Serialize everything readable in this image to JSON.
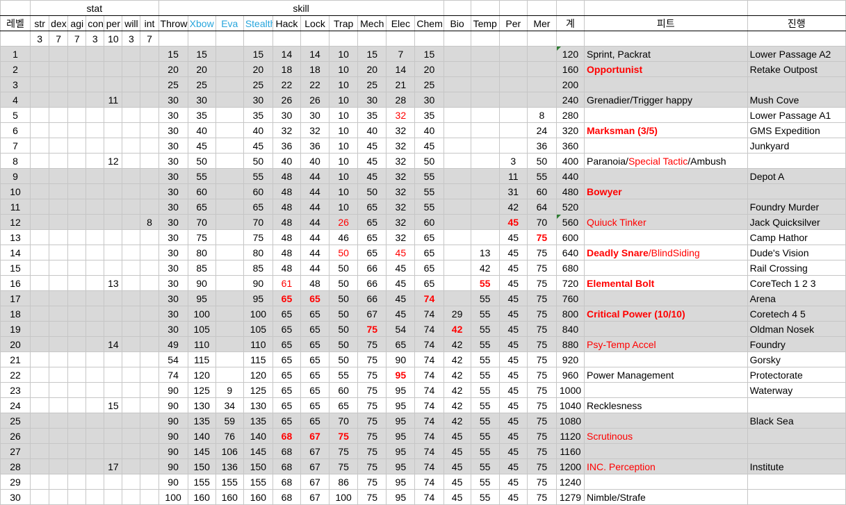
{
  "header": {
    "group_stat": "stat",
    "group_skill": "skill",
    "level": "레벨",
    "stats": [
      "str",
      "dex",
      "agi",
      "con",
      "per",
      "will",
      "int"
    ],
    "skills": [
      "Throw",
      "Xbow",
      "Eva",
      "Stealth",
      "Hack",
      "Lock",
      "Trap",
      "Mech",
      "Elec",
      "Chem",
      "Bio",
      "Temp",
      "Per",
      "Mer"
    ],
    "total": "계",
    "feat": "피트",
    "progress": "진행"
  },
  "base_stats": [
    "3",
    "7",
    "7",
    "3",
    "10",
    "3",
    "7"
  ],
  "rows": [
    {
      "level": "1",
      "stats": [
        "",
        "",
        "",
        "",
        "",
        "",
        ""
      ],
      "skills": [
        "15",
        "15",
        "",
        "15",
        "14",
        "14",
        "10",
        "15",
        "7",
        "15",
        "",
        "",
        "",
        ""
      ],
      "total": "120",
      "feat": [
        {
          "text": "Sprint, Packrat"
        }
      ],
      "progress": "Lower Passage A2",
      "shaded": true
    },
    {
      "level": "2",
      "stats": [
        "",
        "",
        "",
        "",
        "",
        "",
        ""
      ],
      "skills": [
        "20",
        "20",
        "",
        "20",
        "18",
        "18",
        "10",
        "20",
        "14",
        "20",
        "",
        "",
        "",
        ""
      ],
      "total": "160",
      "feat": [
        {
          "text": "Opportunist",
          "red": true,
          "bold": true
        }
      ],
      "progress": "Retake Outpost",
      "shaded": true
    },
    {
      "level": "3",
      "stats": [
        "",
        "",
        "",
        "",
        "",
        "",
        ""
      ],
      "skills": [
        "25",
        "25",
        "",
        "25",
        "22",
        "22",
        "10",
        "25",
        "21",
        "25",
        "",
        "",
        "",
        ""
      ],
      "total": "200",
      "feat": [],
      "progress": "",
      "shaded": true
    },
    {
      "level": "4",
      "stats": [
        "",
        "",
        "",
        "",
        "11",
        "",
        ""
      ],
      "skills": [
        "30",
        "30",
        "",
        "30",
        "26",
        "26",
        "10",
        "30",
        "28",
        "30",
        "",
        "",
        "",
        ""
      ],
      "total": "240",
      "feat": [
        {
          "text": "Grenadier/Trigger happy"
        }
      ],
      "progress": "Mush Cove",
      "shaded": true
    },
    {
      "level": "5",
      "stats": [
        "",
        "",
        "",
        "",
        "",
        "",
        ""
      ],
      "skills": [
        "30",
        "35",
        "",
        "35",
        "30",
        "30",
        "10",
        "35",
        "32",
        "35",
        "",
        "",
        "",
        "8"
      ],
      "total": "280",
      "feat": [],
      "progress": "Lower Passage A1",
      "shaded": false
    },
    {
      "level": "6",
      "stats": [
        "",
        "",
        "",
        "",
        "",
        "",
        ""
      ],
      "skills": [
        "30",
        "40",
        "",
        "40",
        "32",
        "32",
        "10",
        "40",
        "32",
        "40",
        "",
        "",
        "",
        "24"
      ],
      "total": "320",
      "feat": [
        {
          "text": "Marksman (3/5)",
          "red": true,
          "bold": true
        }
      ],
      "progress": "GMS Expedition",
      "shaded": false
    },
    {
      "level": "7",
      "stats": [
        "",
        "",
        "",
        "",
        "",
        "",
        ""
      ],
      "skills": [
        "30",
        "45",
        "",
        "45",
        "36",
        "36",
        "10",
        "45",
        "32",
        "45",
        "",
        "",
        "",
        "36"
      ],
      "total": "360",
      "feat": [],
      "progress": "Junkyard",
      "shaded": false
    },
    {
      "level": "8",
      "stats": [
        "",
        "",
        "",
        "",
        "12",
        "",
        ""
      ],
      "skills": [
        "30",
        "50",
        "",
        "50",
        "40",
        "40",
        "10",
        "45",
        "32",
        "50",
        "",
        "",
        "3",
        "50"
      ],
      "total": "400",
      "feat": [
        {
          "text": "Paranoia/"
        },
        {
          "text": "Special Tactic",
          "red": true
        },
        {
          "text": "/Ambush"
        }
      ],
      "progress": "",
      "shaded": false
    },
    {
      "level": "9",
      "stats": [
        "",
        "",
        "",
        "",
        "",
        "",
        ""
      ],
      "skills": [
        "30",
        "55",
        "",
        "55",
        "48",
        "44",
        "10",
        "45",
        "32",
        "55",
        "",
        "",
        "11",
        "55"
      ],
      "total": "440",
      "feat": [],
      "progress": "Depot A",
      "shaded": true
    },
    {
      "level": "10",
      "stats": [
        "",
        "",
        "",
        "",
        "",
        "",
        ""
      ],
      "skills": [
        "30",
        "60",
        "",
        "60",
        "48",
        "44",
        "10",
        "50",
        "32",
        "55",
        "",
        "",
        "31",
        "60"
      ],
      "total": "480",
      "feat": [
        {
          "text": "Bowyer",
          "red": true,
          "bold": true
        }
      ],
      "progress": "",
      "shaded": true
    },
    {
      "level": "11",
      "stats": [
        "",
        "",
        "",
        "",
        "",
        "",
        ""
      ],
      "skills": [
        "30",
        "65",
        "",
        "65",
        "48",
        "44",
        "10",
        "65",
        "32",
        "55",
        "",
        "",
        "42",
        "64"
      ],
      "total": "520",
      "feat": [],
      "progress": "Foundry Murder",
      "shaded": true
    },
    {
      "level": "12",
      "stats": [
        "",
        "",
        "",
        "",
        "",
        "",
        "8"
      ],
      "skills": [
        "30",
        "70",
        "",
        "70",
        "48",
        "44",
        "26",
        "65",
        "32",
        "60",
        "",
        "",
        "45",
        "70"
      ],
      "total": "560",
      "feat": [
        {
          "text": "Quiuck Tinker",
          "red": true
        }
      ],
      "progress": "Jack Quicksilver",
      "shaded": true
    },
    {
      "level": "13",
      "stats": [
        "",
        "",
        "",
        "",
        "",
        "",
        ""
      ],
      "skills": [
        "30",
        "75",
        "",
        "75",
        "48",
        "44",
        "46",
        "65",
        "32",
        "65",
        "",
        "",
        "45",
        "75"
      ],
      "total": "600",
      "feat": [],
      "progress": "Camp Hathor",
      "shaded": false
    },
    {
      "level": "14",
      "stats": [
        "",
        "",
        "",
        "",
        "",
        "",
        ""
      ],
      "skills": [
        "30",
        "80",
        "",
        "80",
        "48",
        "44",
        "50",
        "65",
        "45",
        "65",
        "",
        "13",
        "45",
        "75"
      ],
      "total": "640",
      "feat": [
        {
          "text": "Deadly Snare",
          "red": true,
          "bold": true
        },
        {
          "text": "/BlindSiding",
          "red": true
        }
      ],
      "progress": "Dude's Vision",
      "shaded": false
    },
    {
      "level": "15",
      "stats": [
        "",
        "",
        "",
        "",
        "",
        "",
        ""
      ],
      "skills": [
        "30",
        "85",
        "",
        "85",
        "48",
        "44",
        "50",
        "66",
        "45",
        "65",
        "",
        "42",
        "45",
        "75"
      ],
      "total": "680",
      "feat": [],
      "progress": "Rail Crossing",
      "shaded": false
    },
    {
      "level": "16",
      "stats": [
        "",
        "",
        "",
        "",
        "13",
        "",
        ""
      ],
      "skills": [
        "30",
        "90",
        "",
        "90",
        "61",
        "48",
        "50",
        "66",
        "45",
        "65",
        "",
        "55",
        "45",
        "75"
      ],
      "total": "720",
      "feat": [
        {
          "text": "Elemental Bolt",
          "red": true,
          "bold": true
        }
      ],
      "progress": "CoreTech 1 2 3",
      "shaded": false
    },
    {
      "level": "17",
      "stats": [
        "",
        "",
        "",
        "",
        "",
        "",
        ""
      ],
      "skills": [
        "30",
        "95",
        "",
        "95",
        "65",
        "65",
        "50",
        "66",
        "45",
        "74",
        "",
        "55",
        "45",
        "75"
      ],
      "total": "760",
      "feat": [],
      "progress": "Arena",
      "shaded": true
    },
    {
      "level": "18",
      "stats": [
        "",
        "",
        "",
        "",
        "",
        "",
        ""
      ],
      "skills": [
        "30",
        "100",
        "",
        "100",
        "65",
        "65",
        "50",
        "67",
        "45",
        "74",
        "29",
        "55",
        "45",
        "75"
      ],
      "total": "800",
      "feat": [
        {
          "text": "Critical Power (10/10)",
          "red": true,
          "bold": true
        }
      ],
      "progress": "Coretech 4 5",
      "shaded": true
    },
    {
      "level": "19",
      "stats": [
        "",
        "",
        "",
        "",
        "",
        "",
        ""
      ],
      "skills": [
        "30",
        "105",
        "",
        "105",
        "65",
        "65",
        "50",
        "75",
        "54",
        "74",
        "42",
        "55",
        "45",
        "75"
      ],
      "total": "840",
      "feat": [],
      "progress": "Oldman Nosek",
      "shaded": true
    },
    {
      "level": "20",
      "stats": [
        "",
        "",
        "",
        "",
        "14",
        "",
        ""
      ],
      "skills": [
        "49",
        "110",
        "",
        "110",
        "65",
        "65",
        "50",
        "75",
        "65",
        "74",
        "42",
        "55",
        "45",
        "75"
      ],
      "total": "880",
      "feat": [
        {
          "text": "Psy-Temp Accel",
          "red": true
        }
      ],
      "progress": "Foundry",
      "shaded": true
    },
    {
      "level": "21",
      "stats": [
        "",
        "",
        "",
        "",
        "",
        "",
        ""
      ],
      "skills": [
        "54",
        "115",
        "",
        "115",
        "65",
        "65",
        "50",
        "75",
        "90",
        "74",
        "42",
        "55",
        "45",
        "75"
      ],
      "total": "920",
      "feat": [],
      "progress": "Gorsky",
      "shaded": false
    },
    {
      "level": "22",
      "stats": [
        "",
        "",
        "",
        "",
        "",
        "",
        ""
      ],
      "skills": [
        "74",
        "120",
        "",
        "120",
        "65",
        "65",
        "55",
        "75",
        "95",
        "74",
        "42",
        "55",
        "45",
        "75"
      ],
      "total": "960",
      "feat": [
        {
          "text": "Power Management"
        }
      ],
      "progress": "Protectorate",
      "shaded": false
    },
    {
      "level": "23",
      "stats": [
        "",
        "",
        "",
        "",
        "",
        "",
        ""
      ],
      "skills": [
        "90",
        "125",
        "9",
        "125",
        "65",
        "65",
        "60",
        "75",
        "95",
        "74",
        "42",
        "55",
        "45",
        "75"
      ],
      "total": "1000",
      "feat": [],
      "progress": "Waterway",
      "shaded": false
    },
    {
      "level": "24",
      "stats": [
        "",
        "",
        "",
        "",
        "15",
        "",
        ""
      ],
      "skills": [
        "90",
        "130",
        "34",
        "130",
        "65",
        "65",
        "65",
        "75",
        "95",
        "74",
        "42",
        "55",
        "45",
        "75"
      ],
      "total": "1040",
      "feat": [
        {
          "text": "Recklesness"
        }
      ],
      "progress": "",
      "shaded": false
    },
    {
      "level": "25",
      "stats": [
        "",
        "",
        "",
        "",
        "",
        "",
        ""
      ],
      "skills": [
        "90",
        "135",
        "59",
        "135",
        "65",
        "65",
        "70",
        "75",
        "95",
        "74",
        "42",
        "55",
        "45",
        "75"
      ],
      "total": "1080",
      "feat": [],
      "progress": "Black Sea",
      "shaded": true
    },
    {
      "level": "26",
      "stats": [
        "",
        "",
        "",
        "",
        "",
        "",
        ""
      ],
      "skills": [
        "90",
        "140",
        "76",
        "140",
        "68",
        "67",
        "75",
        "75",
        "95",
        "74",
        "45",
        "55",
        "45",
        "75"
      ],
      "total": "1120",
      "feat": [
        {
          "text": "Scrutinous",
          "red": true
        }
      ],
      "progress": "",
      "shaded": true
    },
    {
      "level": "27",
      "stats": [
        "",
        "",
        "",
        "",
        "",
        "",
        ""
      ],
      "skills": [
        "90",
        "145",
        "106",
        "145",
        "68",
        "67",
        "75",
        "75",
        "95",
        "74",
        "45",
        "55",
        "45",
        "75"
      ],
      "total": "1160",
      "feat": [],
      "progress": "",
      "shaded": true
    },
    {
      "level": "28",
      "stats": [
        "",
        "",
        "",
        "",
        "17",
        "",
        ""
      ],
      "skills": [
        "90",
        "150",
        "136",
        "150",
        "68",
        "67",
        "75",
        "75",
        "95",
        "74",
        "45",
        "55",
        "45",
        "75"
      ],
      "total": "1200",
      "feat": [
        {
          "text": "INC. Perception",
          "red": true
        }
      ],
      "progress": "Institute",
      "shaded": true
    },
    {
      "level": "29",
      "stats": [
        "",
        "",
        "",
        "",
        "",
        "",
        ""
      ],
      "skills": [
        "90",
        "155",
        "155",
        "155",
        "68",
        "67",
        "86",
        "75",
        "95",
        "74",
        "45",
        "55",
        "45",
        "75"
      ],
      "total": "1240",
      "feat": [],
      "progress": "",
      "shaded": false
    },
    {
      "level": "30",
      "stats": [
        "",
        "",
        "",
        "",
        "",
        "",
        ""
      ],
      "skills": [
        "100",
        "160",
        "160",
        "160",
        "68",
        "67",
        "100",
        "75",
        "95",
        "74",
        "45",
        "55",
        "45",
        "75"
      ],
      "total": "1279",
      "feat": [
        {
          "text": "Nimble/Strafe"
        }
      ],
      "progress": "",
      "shaded": false
    }
  ],
  "highlights": [
    {
      "level": "5",
      "skill": 8
    },
    {
      "level": "12",
      "skill": 6
    },
    {
      "level": "12",
      "skill": 12,
      "bold": true
    },
    {
      "level": "13",
      "skill": 13,
      "bold": true
    },
    {
      "level": "14",
      "skill": 6
    },
    {
      "level": "14",
      "skill": 8
    },
    {
      "level": "16",
      "skill": 4
    },
    {
      "level": "16",
      "skill": 11,
      "bold": true
    },
    {
      "level": "17",
      "skill": 4,
      "bold": true
    },
    {
      "level": "17",
      "skill": 5,
      "bold": true
    },
    {
      "level": "17",
      "skill": 9,
      "bold": true
    },
    {
      "level": "19",
      "skill": 7,
      "bold": true
    },
    {
      "level": "19",
      "skill": 10,
      "bold": true
    },
    {
      "level": "22",
      "skill": 8,
      "bold": true
    },
    {
      "level": "26",
      "skill": 4,
      "bold": true
    },
    {
      "level": "26",
      "skill": 5,
      "bold": true
    },
    {
      "level": "26",
      "skill": 6,
      "bold": true
    }
  ],
  "marked_totals": [
    "1",
    "12"
  ],
  "colors": {
    "shade": "#d9d9d9",
    "grid": "#c6c6c6",
    "header_blue": "#27a5dc",
    "highlight_red": "#ff0000",
    "marker_green": "#2e7d32"
  }
}
